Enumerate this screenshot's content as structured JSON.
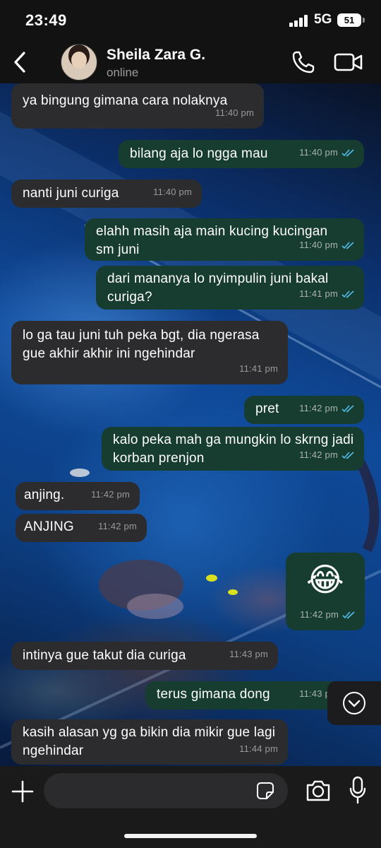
{
  "status_bar": {
    "time": "23:49",
    "network": "5G",
    "battery": "51"
  },
  "header": {
    "contact_name": "Sheila Zara G.",
    "contact_status": "online"
  },
  "messages": [
    {
      "dir": "in",
      "text": "ya bingung gimana cara nolaknya",
      "time": "11:40 pm"
    },
    {
      "dir": "out",
      "text": "bilang aja lo ngga mau",
      "time": "11:40 pm"
    },
    {
      "dir": "in",
      "text": "nanti juni curiga",
      "time": "11:40 pm"
    },
    {
      "dir": "out",
      "text": "elahh masih aja main kucing kucingan sm juni",
      "time": "11:40 pm"
    },
    {
      "dir": "out",
      "text": "dari mananya lo nyimpulin juni bakal curiga?",
      "time": "11:41 pm"
    },
    {
      "dir": "in",
      "text": "lo ga tau juni tuh peka bgt, dia ngerasa gue akhir akhir ini ngehindar",
      "time": "11:41 pm"
    },
    {
      "dir": "out",
      "text": "pret",
      "time": "11:42 pm"
    },
    {
      "dir": "out",
      "text": "kalo peka mah ga mungkin lo skrng jadi korban prenjon",
      "time": "11:42 pm"
    },
    {
      "dir": "in",
      "text": "anjing.",
      "time": "11:42 pm"
    },
    {
      "dir": "in",
      "text": "ANJING",
      "time": "11:42 pm"
    },
    {
      "dir": "out",
      "text": "😂",
      "time": "11:42 pm"
    },
    {
      "dir": "in",
      "text": "intinya gue takut dia curiga",
      "time": "11:43 pm"
    },
    {
      "dir": "out",
      "text": "terus gimana dong",
      "time": "11:43 pm"
    },
    {
      "dir": "in",
      "text": "kasih alasan yg ga bikin dia mikir gue lagi ngehindar",
      "time": "11:44 pm"
    }
  ],
  "composer": {
    "placeholder": ""
  },
  "icons": {
    "back": "chevron-left-icon",
    "call": "phone-icon",
    "video": "video-camera-icon",
    "scroll_down": "chevron-down-circle-icon",
    "plus": "plus-icon",
    "sticker": "sticker-icon",
    "camera": "camera-icon",
    "mic": "microphone-icon",
    "read": "double-check-icon"
  },
  "colors": {
    "incoming_bubble": "#2c2c2e",
    "outgoing_bubble": "#173d30",
    "read_ticks": "#53bdeb",
    "header_bg": "#121212"
  }
}
